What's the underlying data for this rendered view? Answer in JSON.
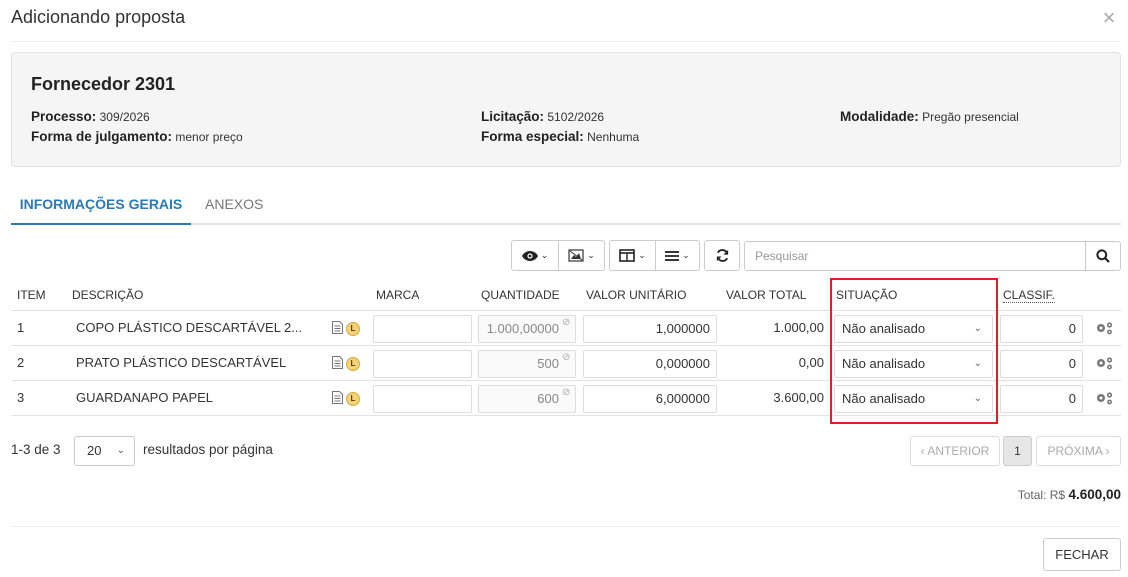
{
  "modal": {
    "title": "Adicionando proposta",
    "close_icon": "×"
  },
  "supplier": {
    "name": "Fornecedor 2301",
    "processo_label": "Processo:",
    "processo": "309/2026",
    "licitacao_label": "Licitação:",
    "licitacao": "5102/2026",
    "modalidade_label": "Modalidade:",
    "modalidade": "Pregão presencial",
    "julgamento_label": "Forma de julgamento:",
    "julgamento": "menor preço",
    "especial_label": "Forma especial:",
    "especial": "Nenhuma"
  },
  "tabs": [
    {
      "label": "INFORMAÇÕES GERAIS",
      "active": true
    },
    {
      "label": "ANEXOS",
      "active": false
    }
  ],
  "search": {
    "placeholder": "Pesquisar"
  },
  "table": {
    "headers": {
      "item": "ITEM",
      "descricao": "DESCRIÇÃO",
      "marca": "MARCA",
      "quantidade": "QUANTIDADE",
      "valor_unitario": "VALOR UNITÁRIO",
      "valor_total": "VALOR TOTAL",
      "situacao": "SITUAÇÃO",
      "classif": "CLASSIF."
    },
    "rows": [
      {
        "item": "1",
        "descricao": "COPO PLÁSTICO DESCARTÁVEL 2...",
        "badge": "L",
        "marca": "",
        "quantidade": "1.000,00000",
        "valor_unitario": "1,000000",
        "valor_total": "1.000,00",
        "situacao": "Não analisado",
        "classif": "0"
      },
      {
        "item": "2",
        "descricao": "PRATO PLÁSTICO DESCARTÁVEL",
        "badge": "L",
        "marca": "",
        "quantidade": "500",
        "valor_unitario": "0,000000",
        "valor_total": "0,00",
        "situacao": "Não analisado",
        "classif": "0"
      },
      {
        "item": "3",
        "descricao": "GUARDANAPO PAPEL",
        "badge": "L",
        "marca": "",
        "quantidade": "600",
        "valor_unitario": "6,000000",
        "valor_total": "3.600,00",
        "situacao": "Não analisado",
        "classif": "0"
      }
    ]
  },
  "pagination": {
    "range": "1-3 de 3",
    "per_page": "20",
    "per_page_label": "resultados por página",
    "prev": "‹ ANTERIOR",
    "current": "1",
    "next": "PRÓXIMA ›"
  },
  "total": {
    "label": "Total:",
    "currency": "R$",
    "value": "4.600,00"
  },
  "footer": {
    "close_label": "FECHAR"
  },
  "colors": {
    "accent": "#2a7ab8",
    "highlight": "#e02020",
    "badge": "#f4d27a"
  }
}
